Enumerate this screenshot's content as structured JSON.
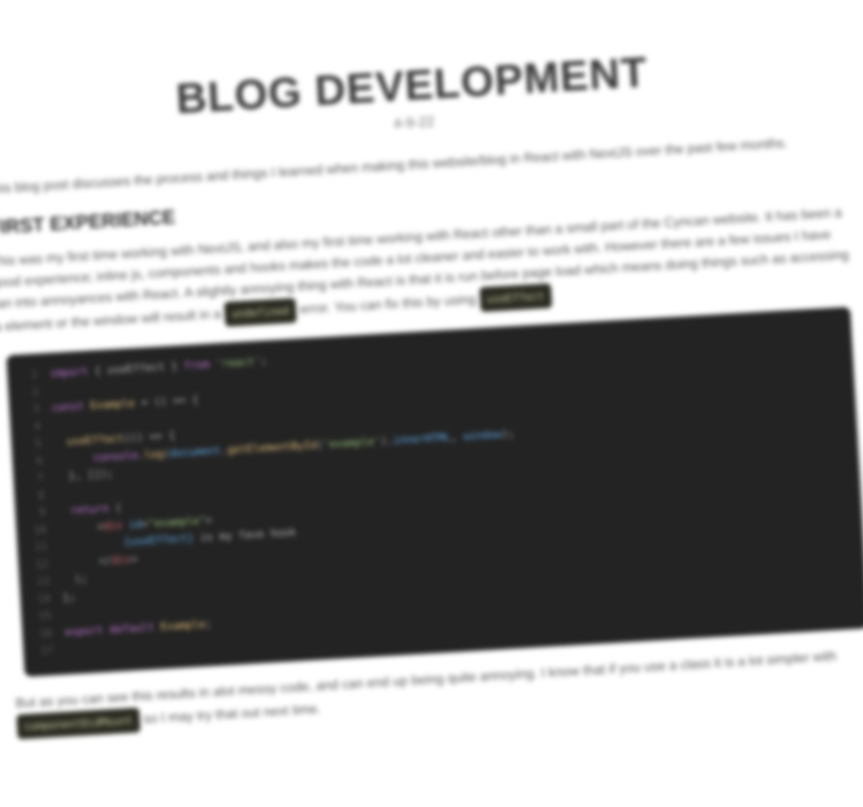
{
  "post": {
    "title": "BLOG DEVELOPMENT",
    "date": "4-9-22",
    "intro": "This blog post discusses the process and things I learned when making this website/blog in React with NextJS over the past few months.",
    "section_heading": "FIRST EXPERIENCE",
    "para1_a": "This was my first time working with NextJS, and also my first time working with React other than a small part of the Cyncan website. It has been a good experience; inline js, components and hooks makes the code a lot cleaner and easier to work with. However there are a few issues I have ran into annoyances with React. A slightly annoying thing with React is that it is run before page load which means doing things such as accessing a element or the window will result in a",
    "inline1": "undefined",
    "para1_b": "error. You can fix this by using",
    "inline2": "useEffect",
    "para2_a": "But as you can see this results in alot messy code, and can end up being quite annoying. I know that if you use a class it is a lot simpler with",
    "inline3": "componentDidMount",
    "para2_b": "so I may try that out next time."
  },
  "code": {
    "lines": [
      {
        "n": "1",
        "tokens": [
          {
            "c": "kw",
            "t": "import "
          },
          {
            "c": "pl",
            "t": "{ useEffect } "
          },
          {
            "c": "kw",
            "t": "from "
          },
          {
            "c": "str",
            "t": "'react'"
          },
          {
            "c": "pl",
            "t": ";"
          }
        ]
      },
      {
        "n": "2",
        "tokens": []
      },
      {
        "n": "3",
        "tokens": [
          {
            "c": "kw",
            "t": "const "
          },
          {
            "c": "fn",
            "t": "Example "
          },
          {
            "c": "pl",
            "t": "= () => {"
          }
        ]
      },
      {
        "n": "4",
        "tokens": []
      },
      {
        "n": "5",
        "tokens": [
          {
            "c": "pl",
            "t": "  "
          },
          {
            "c": "fn",
            "t": "useEffect"
          },
          {
            "c": "pl",
            "t": "(() => {"
          }
        ]
      },
      {
        "n": "6",
        "tokens": [
          {
            "c": "pl",
            "t": "      "
          },
          {
            "c": "kw",
            "t": "console"
          },
          {
            "c": "pl",
            "t": "."
          },
          {
            "c": "fn",
            "t": "log"
          },
          {
            "c": "pl",
            "t": "("
          },
          {
            "c": "var",
            "t": "document"
          },
          {
            "c": "pl",
            "t": "."
          },
          {
            "c": "fn",
            "t": "getElementById"
          },
          {
            "c": "pl",
            "t": "("
          },
          {
            "c": "str",
            "t": "'example'"
          },
          {
            "c": "pl",
            "t": ")."
          },
          {
            "c": "var",
            "t": "innerHTML"
          },
          {
            "c": "pl",
            "t": ", "
          },
          {
            "c": "var",
            "t": "window"
          },
          {
            "c": "pl",
            "t": ");"
          }
        ]
      },
      {
        "n": "7",
        "tokens": [
          {
            "c": "pl",
            "t": "  }, []);"
          }
        ]
      },
      {
        "n": "8",
        "tokens": []
      },
      {
        "n": "9",
        "tokens": [
          {
            "c": "pl",
            "t": "  "
          },
          {
            "c": "kw",
            "t": "return "
          },
          {
            "c": "pl",
            "t": "("
          }
        ]
      },
      {
        "n": "10",
        "tokens": [
          {
            "c": "pl",
            "t": "      <"
          },
          {
            "c": "tag",
            "t": "div "
          },
          {
            "c": "var",
            "t": "id"
          },
          {
            "c": "pl",
            "t": "="
          },
          {
            "c": "str",
            "t": "\"example\""
          },
          {
            "c": "pl",
            "t": ">"
          }
        ]
      },
      {
        "n": "11",
        "tokens": [
          {
            "c": "pl",
            "t": "          "
          },
          {
            "c": "var",
            "t": "{useEffect}"
          },
          {
            "c": "pl",
            "t": " is my fave hook"
          }
        ]
      },
      {
        "n": "12",
        "tokens": [
          {
            "c": "pl",
            "t": "      </"
          },
          {
            "c": "tag",
            "t": "div"
          },
          {
            "c": "pl",
            "t": ">"
          }
        ]
      },
      {
        "n": "13",
        "tokens": [
          {
            "c": "pl",
            "t": "  );"
          }
        ]
      },
      {
        "n": "14",
        "tokens": [
          {
            "c": "pl",
            "t": "};"
          }
        ]
      },
      {
        "n": "15",
        "tokens": []
      },
      {
        "n": "16",
        "tokens": [
          {
            "c": "kw",
            "t": "export default "
          },
          {
            "c": "fn",
            "t": "Example"
          },
          {
            "c": "pl",
            "t": ";"
          }
        ]
      },
      {
        "n": "17",
        "tokens": []
      }
    ]
  }
}
